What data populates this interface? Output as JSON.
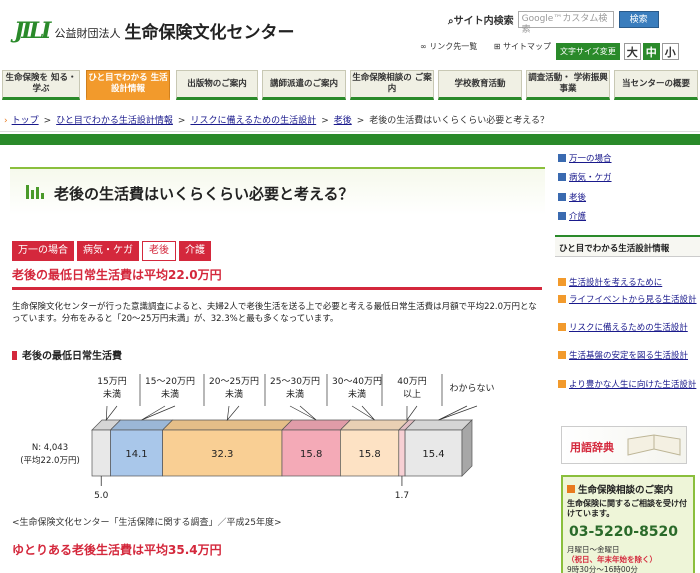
{
  "header": {
    "logo_mark": "JILI",
    "org_prefix": "公益財団法人",
    "org_name": "生命保険文化センター",
    "search_label": "サイト内検索",
    "search_placeholder": "Google™カスタム検索",
    "search_button": "検索",
    "link_links": "リンク先一覧",
    "link_sitemap": "サイトマップ",
    "font_size_label": "文字サイズ変更",
    "font_large": "大",
    "font_medium": "中",
    "font_small": "小"
  },
  "nav": {
    "tabs": [
      {
        "label": "生命保険を 知る・学ぶ"
      },
      {
        "label": "ひと目でわかる 生活設計情報"
      },
      {
        "label": "出版物のご案内"
      },
      {
        "label": "講師派遣のご案内"
      },
      {
        "label": "生命保険相談の ご案内"
      },
      {
        "label": "学校教育活動"
      },
      {
        "label": "調査活動・ 学術振興事業"
      },
      {
        "label": "当センターの概要"
      }
    ],
    "active_index": 1
  },
  "breadcrumb": [
    "トップ",
    "ひと目でわかる生活設計情報",
    "リスクに備えるための生活設計",
    "老後",
    "老後の生活費はいくらくらい必要と考える？"
  ],
  "page": {
    "title": "老後の生活費はいくらくらい必要と考える？",
    "categories": [
      "万一の場合",
      "病気・ケガ",
      "老後",
      "介護"
    ],
    "active_category": 2,
    "heading1": "老後の最低日常生活費は平均22.0万円",
    "paragraph": "生命保険文化センターが行った意識調査によると、夫婦2人で老後生活を送る上で必要と考える最低日常生活費は月額で平均22.0万円となっています。分布をみると「20～25万円未満」が、32.3%と最も多くなっています。",
    "chart_heading": "老後の最低日常生活費",
    "source": "<生命保険文化センター「生活保障に関する調査」／平成25年度>",
    "heading2": "ゆとりある老後生活費は平均35.4万円"
  },
  "chart_data": {
    "type": "bar",
    "orientation": "horizontal-stacked",
    "categories": [
      "15万円未満",
      "15～20万円未満",
      "20～25万円未満",
      "25～30万円未満",
      "30～40万円未満",
      "40万円以上",
      "わからない"
    ],
    "row_label": "N: 4,043 (平均22.0万円)",
    "values": [
      5.0,
      14.1,
      32.3,
      15.8,
      15.8,
      1.7,
      15.4
    ],
    "colors": [
      "#e8e8e8",
      "#a9c7ea",
      "#f9cf94",
      "#f4aab7",
      "#fde2c4",
      "#f7d0d4",
      "#e8e8e8"
    ],
    "labels": [
      "15万円\n未満",
      "15～20万円\n未満",
      "20～25万円\n未満",
      "25～30万円\n未満",
      "30～40万円\n未満",
      "40万円\n以上",
      "わからない"
    ]
  },
  "sidebar": {
    "top_links": [
      "万一の場合",
      "病気・ケガ",
      "老後",
      "介護"
    ],
    "section_title": "ひと目でわかる生活設計情報",
    "links": [
      "生活設計を考えるために",
      "ライフイベントから見る生活設計",
      "リスクに備えるための生活設計",
      "生活基盤の安定を図る生活設計",
      "より豊かな人生に向けた生活設計"
    ],
    "dictionary": "用語辞典",
    "consult_title": "生命保険相談のご案内",
    "consult_desc": "生命保険に関するご相談を受け付けています。",
    "consult_phone": "03-5220-8520",
    "consult_days": "月曜日～金曜日",
    "consult_note": "（祝日、年末年始を除く）",
    "consult_time": "9時30分～16時00分"
  },
  "colors": {
    "brand_green": "#2a8a2a",
    "accent_orange": "#f29a2c",
    "accent_red": "#d4283c"
  }
}
